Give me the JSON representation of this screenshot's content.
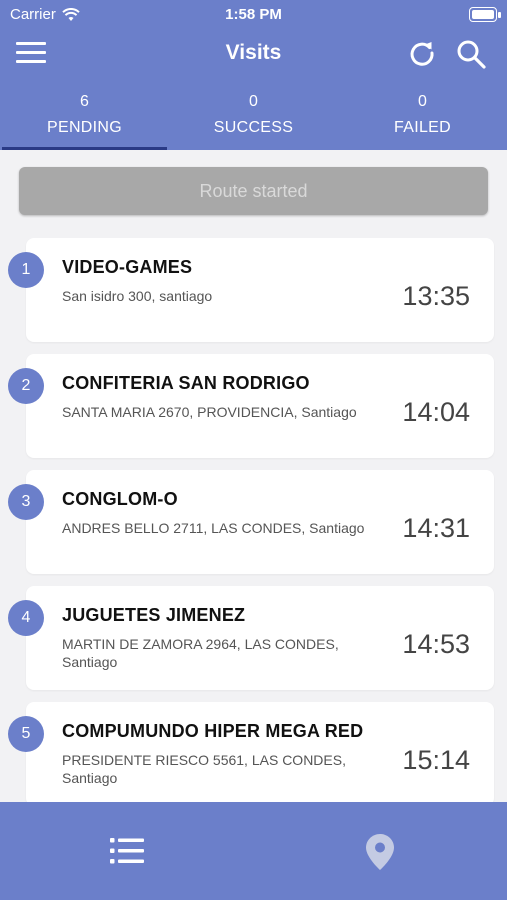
{
  "status": {
    "carrier": "Carrier",
    "time": "1:58 PM"
  },
  "header": {
    "title": "Visits"
  },
  "tabs": [
    {
      "count": "6",
      "label": "PENDING"
    },
    {
      "count": "0",
      "label": "SUCCESS"
    },
    {
      "count": "0",
      "label": "FAILED"
    }
  ],
  "route_button": {
    "label": "Route started"
  },
  "visits": [
    {
      "number": "1",
      "name": "VIDEO-GAMES",
      "address": "San isidro 300, santiago",
      "time": "13:35"
    },
    {
      "number": "2",
      "name": "CONFITERIA SAN RODRIGO",
      "address": "SANTA MARIA 2670, PROVIDENCIA, Santiago",
      "time": "14:04"
    },
    {
      "number": "3",
      "name": "CONGLOM-O",
      "address": "ANDRES BELLO 2711, LAS CONDES, Santiago",
      "time": "14:31"
    },
    {
      "number": "4",
      "name": "JUGUETES JIMENEZ",
      "address": "MARTIN DE ZAMORA 2964, LAS CONDES, Santiago",
      "time": "14:53"
    },
    {
      "number": "5",
      "name": "COMPUMUNDO HIPER MEGA RED",
      "address": "PRESIDENTE RIESCO 5561, LAS CONDES, Santiago",
      "time": "15:14"
    }
  ],
  "colors": {
    "primary": "#6b7fca",
    "active_tab_underline": "#2a3a86",
    "disabled_button": "#a8a8a8"
  },
  "icons": {
    "menu": "hamburger-menu-icon",
    "refresh": "refresh-icon",
    "search": "search-icon",
    "list": "list-icon",
    "map": "map-pin-icon",
    "wifi": "wifi-icon",
    "battery": "battery-icon"
  }
}
